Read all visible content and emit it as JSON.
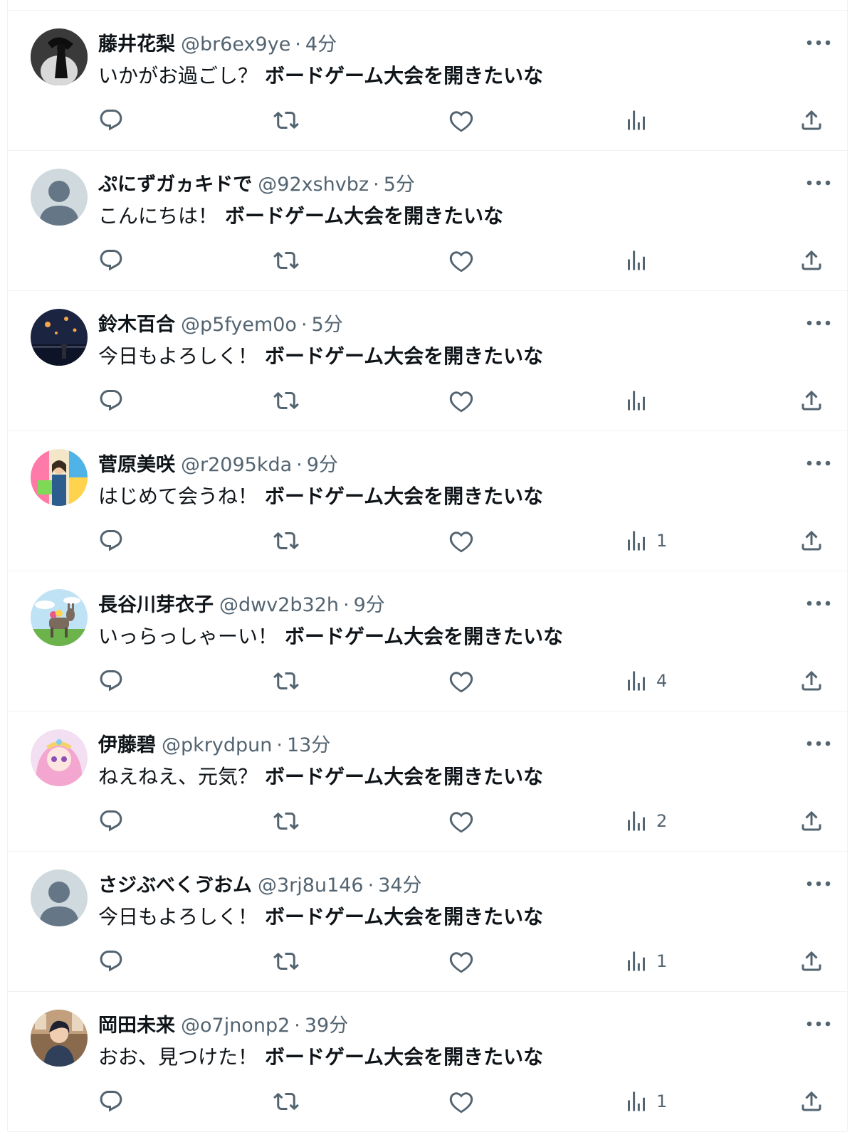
{
  "colors": {
    "text": "#0f1419",
    "secondary": "#536471",
    "border": "#eff3f4"
  },
  "icons": {
    "reply": "reply-icon",
    "retweet": "retweet-icon",
    "like": "heart-icon",
    "views": "analytics-icon",
    "share": "share-icon",
    "more": "more-icon"
  },
  "tweets": [
    {
      "name": "藤井花梨",
      "handle": "@br6ex9ye",
      "time": "4分",
      "greeting": "いかがお過ごし？",
      "text": "ボードゲーム大会を開きたいな",
      "views": ""
    },
    {
      "name": "ぷにずガヵキドで",
      "handle": "@92xshvbz",
      "time": "5分",
      "greeting": "こんにちは！",
      "text": "ボードゲーム大会を開きたいな",
      "views": ""
    },
    {
      "name": "鈴木百合",
      "handle": "@p5fyem0o",
      "time": "5分",
      "greeting": "今日もよろしく！",
      "text": "ボードゲーム大会を開きたいな",
      "views": ""
    },
    {
      "name": "菅原美咲",
      "handle": "@r2095kda",
      "time": "9分",
      "greeting": "はじめて会うね！",
      "text": "ボードゲーム大会を開きたいな",
      "views": "1"
    },
    {
      "name": "長谷川芽衣子",
      "handle": "@dwv2b32h",
      "time": "9分",
      "greeting": "いっらっしゃーい！",
      "text": "ボードゲーム大会を開きたいな",
      "views": "4"
    },
    {
      "name": "伊藤碧",
      "handle": "@pkrydpun",
      "time": "13分",
      "greeting": "ねえねえ、元気？",
      "text": "ボードゲーム大会を開きたいな",
      "views": "2"
    },
    {
      "name": "さジぶべくゔおム",
      "handle": "@3rj8u146",
      "time": "34分",
      "greeting": "今日もよろしく！",
      "text": "ボードゲーム大会を開きたいな",
      "views": "1"
    },
    {
      "name": "岡田未来",
      "handle": "@o7jnonp2",
      "time": "39分",
      "greeting": "おお、見つけた！",
      "text": "ボードゲーム大会を開きたいな",
      "views": "1"
    }
  ]
}
